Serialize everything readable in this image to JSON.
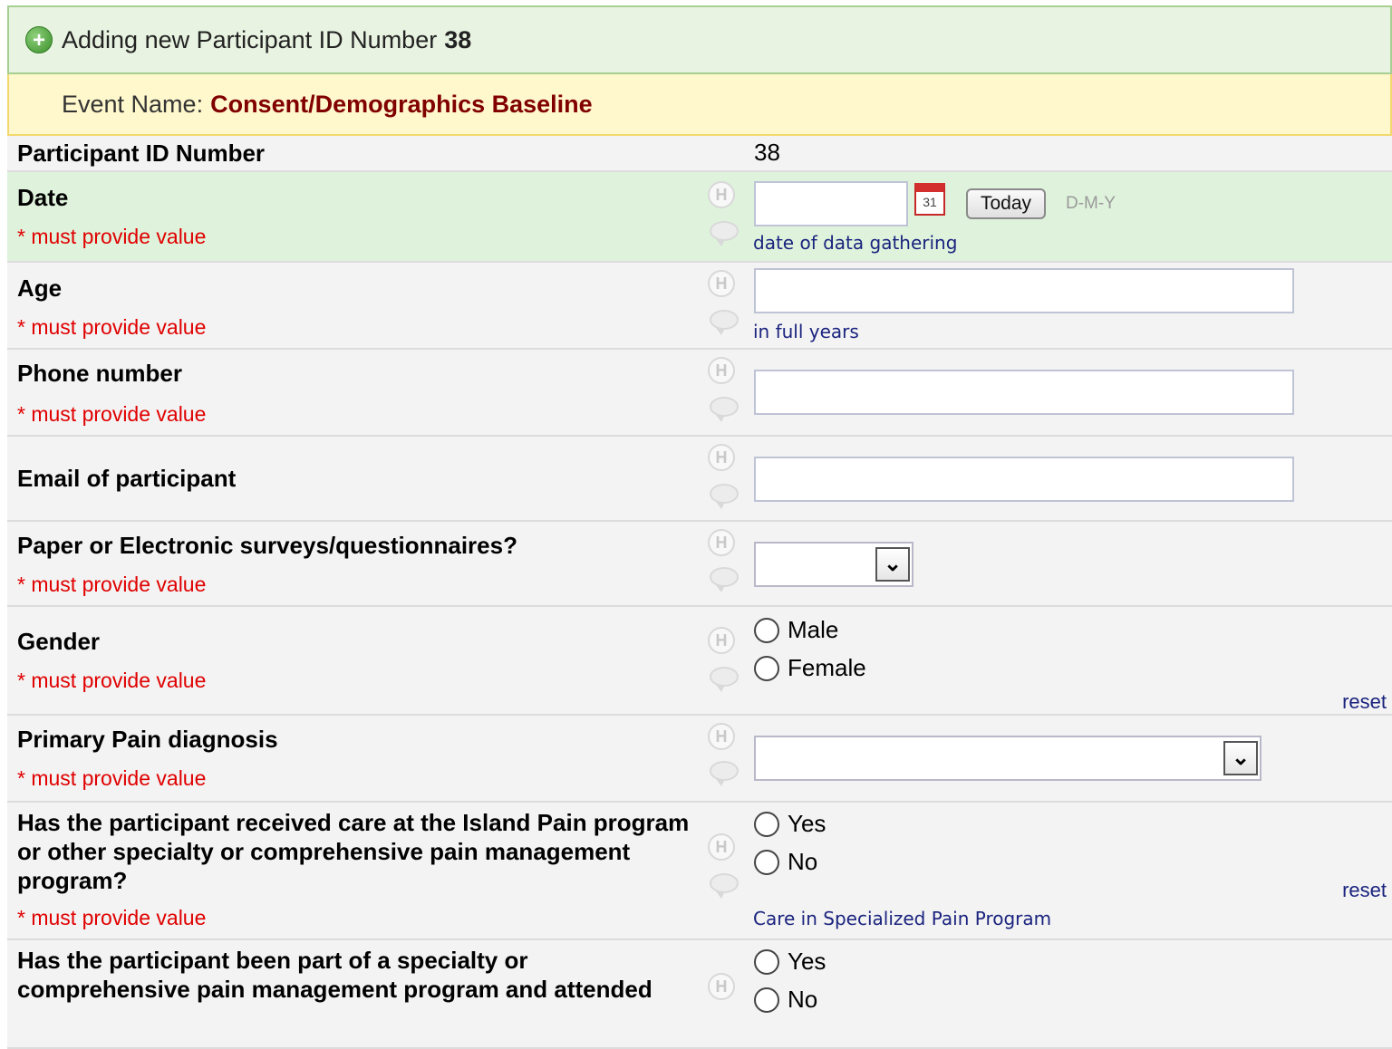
{
  "header": {
    "title_prefix": "Adding new Participant ID Number",
    "record_id": "38"
  },
  "event": {
    "label": "Event Name:",
    "value": "Consent/Demographics Baseline"
  },
  "form": {
    "required_text": "* must provide value",
    "help_icon_letter": "H",
    "participant_id": {
      "label": "Participant ID Number",
      "value": "38"
    },
    "date": {
      "label": "Date",
      "value": "",
      "today_button": "Today",
      "format_hint": "D-M-Y",
      "note": "date of data gathering",
      "calendar_day": "31"
    },
    "age": {
      "label": "Age",
      "value": "",
      "note": "in full years"
    },
    "phone": {
      "label": "Phone number",
      "value": ""
    },
    "email": {
      "label": "Email of participant",
      "value": ""
    },
    "survey_type": {
      "label": "Paper or Electronic surveys/questionnaires?",
      "selected": ""
    },
    "gender": {
      "label": "Gender",
      "options": [
        "Male",
        "Female"
      ],
      "reset": "reset"
    },
    "pain_dx": {
      "label": "Primary Pain diagnosis",
      "selected": ""
    },
    "care_program": {
      "label": "Has the participant received care at the Island Pain program or other specialty or comprehensive pain management program?",
      "options": [
        "Yes",
        "No"
      ],
      "reset": "reset",
      "note": "Care in Specialized Pain Program"
    },
    "program_attended": {
      "label": "Has the participant been part of a specialty or comprehensive pain management program and attended",
      "options": [
        "Yes",
        "No"
      ]
    }
  },
  "colors": {
    "required": "#e00000",
    "event_value": "#800000",
    "note": "#1a237e",
    "header_bg": "#e8f3e1",
    "event_bg": "#fff8cc",
    "highlight_row": "#dff3dc"
  }
}
